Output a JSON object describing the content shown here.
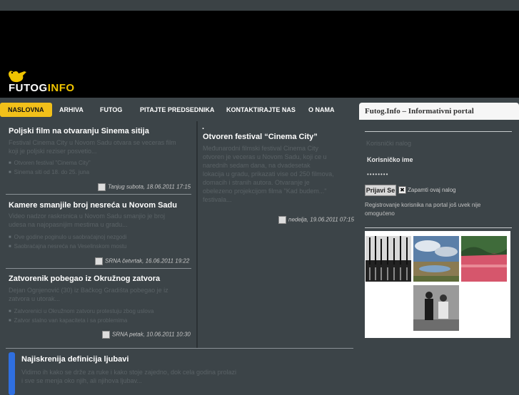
{
  "brand": {
    "name_part1": "FUTOG",
    "name_part2": "INFO"
  },
  "nav": {
    "items": [
      "NASLOVNA",
      "ARHIVA",
      "FUTOG",
      "PITAJTE PREDSEDNIKA",
      "KONTAKTIRAJTE NAS",
      "O NAMA"
    ],
    "active": "NASLOVNA"
  },
  "articles_left": [
    {
      "title": "Poljski film na otvaranju Sinema sitija",
      "summary_lines": [
        "Festival Cinema City u Novom Sadu otvara se veceras film",
        "koji je poljski reziser posvetio..."
      ],
      "bullets": [
        "Otvoren festival \"Cinema City\"",
        "Sinema siti od 18. do 25. juna"
      ],
      "meta": "Tanjug subota, 18.06.2011 17:15"
    },
    {
      "title": "Kamere smanjile broj nesreća u Novom Sadu",
      "summary_lines": [
        "Video nadzor raskrsnica u Novom Sadu smanjio je broj",
        "udesa na najopasnijim mestima u gradu..."
      ],
      "bullets": [
        "Ove godine poginulo u saobraćajnoj nezgodi",
        "Saobraćajna nesreća na Veselinskom mostu"
      ],
      "meta": "SRNA četvrtak, 16.06.2011 19:22"
    },
    {
      "title": "Zatvorenik pobegao iz Okružnog zatvora",
      "summary_lines": [
        "Dejan Ognjenović (30) iz Bačkog Gradišta pobegao je iz",
        "zatvora u utorak..."
      ],
      "bullets": [
        "Zatvorenici u Okružnom zatvoru protestuju zbog uslova",
        "Zatvor stalno van kapaciteta i sa problemima"
      ],
      "meta": "SRNA petak, 10.06.2011 10:30"
    }
  ],
  "article_right": {
    "dot": ".",
    "title": "Otvoren festival “Cinema City”",
    "summary_lines": [
      "Međunarodni filmski festival Cinema City",
      "otvoren je veceras u Novom Sadu, koji ce u",
      "narednih sedam dana, na dvadesetak",
      "lokacija u gradu, prikazati vise od 250 filmova,",
      "domacih i stranih autora. Otvaranje je",
      "obelezeno projekcijom filma \"Kad budem...\"",
      "festivala..."
    ],
    "meta": "nedelja, 19.06.2011 07:15"
  },
  "bottom_article": {
    "title": "Najiskrenija definicija ljubavi",
    "summary_lines": [
      "Vidimo ih kako se drže za ruke i kako stoje zajedno, dok cela godina prolazi",
      "i sve se menja oko njih, ali njihova ljubav..."
    ]
  },
  "sidebar": {
    "title": "Futog.Info – Informativni portal",
    "form_heading": "Korisnički nalog",
    "username_label": "Korisničko ime",
    "password_value": "••••••••",
    "login_button": "Prijavi Se",
    "remember_label": "Zapamti ovaj nalog",
    "register_text_lines": [
      "Registrovanje korisnika na portal još uvek nije",
      "omogućeno"
    ]
  },
  "colors": {
    "accent": "#f2c01a",
    "header_bg": "#000000",
    "page_bg": "#3c4448",
    "text_dim": "#5a6266"
  }
}
